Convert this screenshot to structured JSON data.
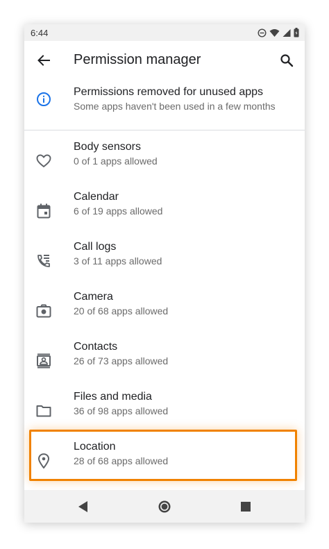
{
  "status_bar": {
    "time": "6:44",
    "icons": [
      "do-not-disturb-icon",
      "wifi-icon",
      "signal-icon",
      "battery-icon"
    ]
  },
  "app_bar": {
    "title": "Permission manager",
    "back_icon": "arrow-back-icon",
    "search_icon": "search-icon"
  },
  "banner": {
    "title": "Permissions removed for unused apps",
    "subtitle": "Some apps haven't been used in a few months",
    "icon": "info-icon",
    "accent": "#1a73e8"
  },
  "permissions": [
    {
      "label": "Body sensors",
      "summary": "0 of 1 apps allowed",
      "icon": "heart-icon"
    },
    {
      "label": "Calendar",
      "summary": "6 of 19 apps allowed",
      "icon": "calendar-icon"
    },
    {
      "label": "Call logs",
      "summary": "3 of 11 apps allowed",
      "icon": "call-log-icon"
    },
    {
      "label": "Camera",
      "summary": "20 of 68 apps allowed",
      "icon": "camera-icon"
    },
    {
      "label": "Contacts",
      "summary": "26 of 73 apps allowed",
      "icon": "contacts-icon"
    },
    {
      "label": "Files and media",
      "summary": "36 of 98 apps allowed",
      "icon": "folder-icon"
    },
    {
      "label": "Location",
      "summary": "28 of 68 apps allowed",
      "icon": "location-pin-icon"
    }
  ],
  "highlight_color": "#f08200",
  "nav_bar": {
    "icons": [
      "back-triangle-icon",
      "home-circle-icon",
      "recents-square-icon"
    ]
  }
}
